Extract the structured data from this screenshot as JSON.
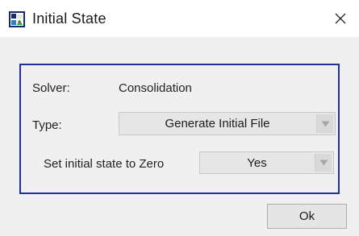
{
  "window": {
    "title": "Initial State",
    "app_icon": "fem-app-icon",
    "close_icon": "close-icon"
  },
  "panel": {
    "solver_label": "Solver:",
    "solver_value": "Consolidation",
    "type_label": "Type:",
    "type_selected": "Generate Initial File",
    "zero_label": "Set initial state to Zero",
    "zero_selected": "Yes",
    "border_color": "#1f2f9e"
  },
  "buttons": {
    "ok_label": "Ok"
  }
}
